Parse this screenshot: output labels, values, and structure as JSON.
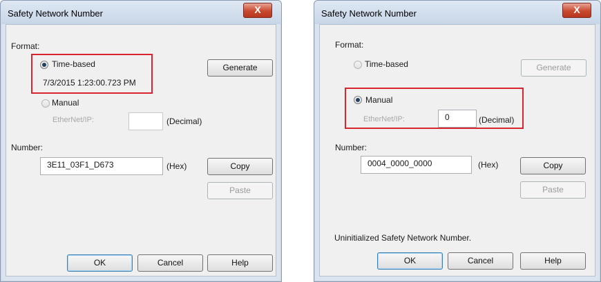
{
  "dialogs": [
    {
      "title": "Safety Network Number",
      "close_label": "X",
      "format_label": "Format:",
      "time_based_label": "Time-based",
      "timestamp": "7/3/2015 1:23:00.723 PM",
      "generate_label": "Generate",
      "manual_label": "Manual",
      "ethernet_label": "EtherNet/IP:",
      "ethernet_value": "",
      "decimal_label": "(Decimal)",
      "number_label": "Number:",
      "number_value": "3E11_03F1_D673",
      "hex_label": "(Hex)",
      "copy_label": "Copy",
      "paste_label": "Paste",
      "status_text": "",
      "ok_label": "OK",
      "cancel_label": "Cancel",
      "help_label": "Help",
      "selected_format": "Time-based"
    },
    {
      "title": "Safety Network Number",
      "close_label": "X",
      "format_label": "Format:",
      "time_based_label": "Time-based",
      "timestamp": "",
      "generate_label": "Generate",
      "manual_label": "Manual",
      "ethernet_label": "EtherNet/IP:",
      "ethernet_value": "0",
      "decimal_label": "(Decimal)",
      "number_label": "Number:",
      "number_value": "0004_0000_0000",
      "hex_label": "(Hex)",
      "copy_label": "Copy",
      "paste_label": "Paste",
      "status_text": "Uninitialized Safety Network Number.",
      "ok_label": "OK",
      "cancel_label": "Cancel",
      "help_label": "Help",
      "selected_format": "Manual"
    }
  ],
  "colors": {
    "highlight": "#d9232d",
    "close_button": "#c9492f",
    "dialog_frame": "#dbe4ee"
  }
}
